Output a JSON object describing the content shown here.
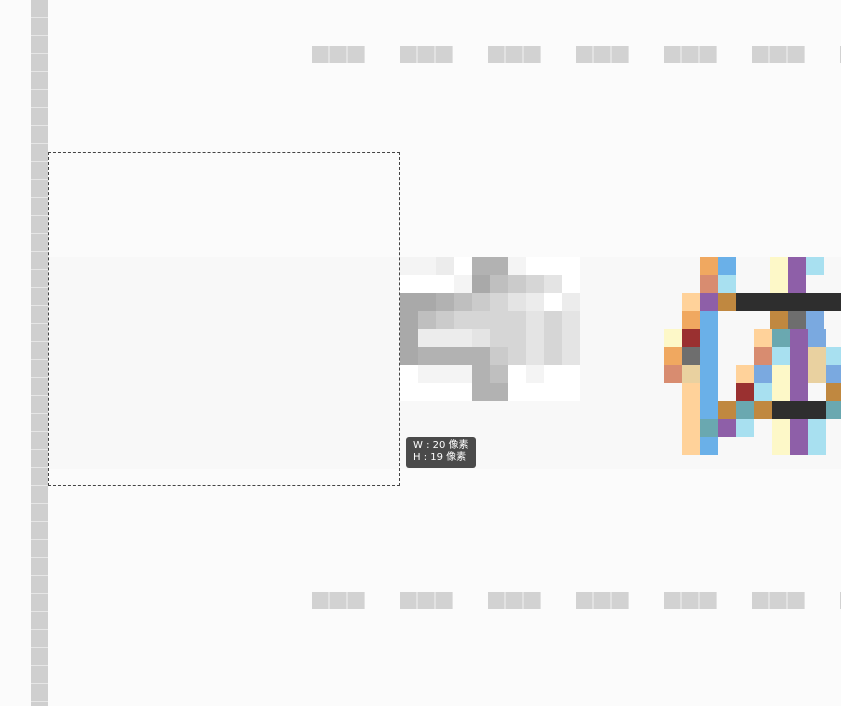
{
  "canvas": {
    "ruler_color": "#cfcfcf",
    "placeholder_color": "#d2d2d2"
  },
  "selection_tooltip": {
    "width_line": "W : 20 像素",
    "height_line": "H : 19 像素"
  },
  "pixel_art_grays": [
    "#ffffff",
    "#f4f4f4",
    "#ececec",
    "#e4e4e4",
    "#d6d6d6",
    "#cbcbcb",
    "#bfbfbf",
    "#b2b2b2",
    "#a9a9a9"
  ],
  "pixel_art_colors": [
    "#f0a860",
    "#6ab0e8",
    "#fdf8c8",
    "#8e5fa8",
    "#2e2e2e",
    "#7aa9e0",
    "#d88c70",
    "#ffd29a",
    "#9a3030",
    "#6e6e6e",
    "#f4a070",
    "#e9d1a0",
    "#a8e0f0",
    "#c08840",
    "#6aa8b0"
  ]
}
